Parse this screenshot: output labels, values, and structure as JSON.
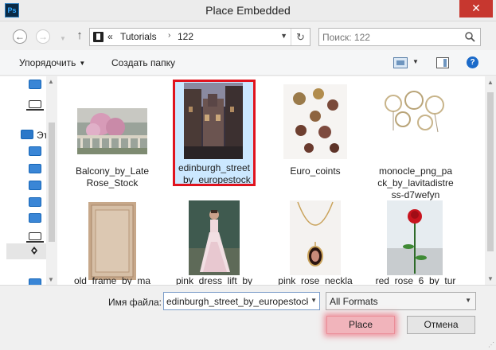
{
  "window": {
    "title": "Place Embedded",
    "app_icon": "Ps",
    "close": "✕"
  },
  "address_bar": {
    "back_icon": "←",
    "forward_icon": "→",
    "up_icon": "↑",
    "prefix": "«",
    "path": [
      "Tutorials",
      "122"
    ],
    "separator": "›",
    "refresh_icon": "↻",
    "search_placeholder": "Поиск: 122"
  },
  "toolbar": {
    "organize": "Упорядочить",
    "new_folder": "Создать папку",
    "help": "?"
  },
  "nav_pane": {
    "computer_label": "Эт"
  },
  "files": [
    {
      "name": "Balcony_by_Late Rose_Stock",
      "lines": [
        "Balcony_by_Late",
        "Rose_Stock"
      ],
      "selected": false
    },
    {
      "name": "edinburgh_street_by_europestock",
      "lines": [
        "edinburgh_street",
        "_by_europestock"
      ],
      "selected": true
    },
    {
      "name": "Euro_coints",
      "lines": [
        "Euro_coints"
      ],
      "selected": false
    },
    {
      "name": "monocle_png_pack_by_lavitadistress-d7wefyn",
      "lines": [
        "monocle_png_pa",
        "ck_by_lavitadistre",
        "ss-d7wefyn"
      ],
      "selected": false
    },
    {
      "name": "old_frame_by_ma",
      "lines": [
        "old_frame_by_ma"
      ],
      "selected": false
    },
    {
      "name": "pink_dress_lift_by",
      "lines": [
        "pink_dress_lift_by"
      ],
      "selected": false
    },
    {
      "name": "pink_rose_neckla",
      "lines": [
        "pink_rose_neckla"
      ],
      "selected": false
    },
    {
      "name": "red_rose_6_by_tur",
      "lines": [
        "red_rose_6_by_tur"
      ],
      "selected": false
    }
  ],
  "bottom": {
    "filename_label": "Имя файла:",
    "filename_value": "edinburgh_street_by_europestock",
    "format": "All Formats",
    "place": "Place",
    "cancel": "Отмена"
  },
  "colors": {
    "selection_frame": "#e0141e",
    "selected_tile": "#cce8ff",
    "place_glow": "#eb465a",
    "close_button": "#c7372f"
  }
}
